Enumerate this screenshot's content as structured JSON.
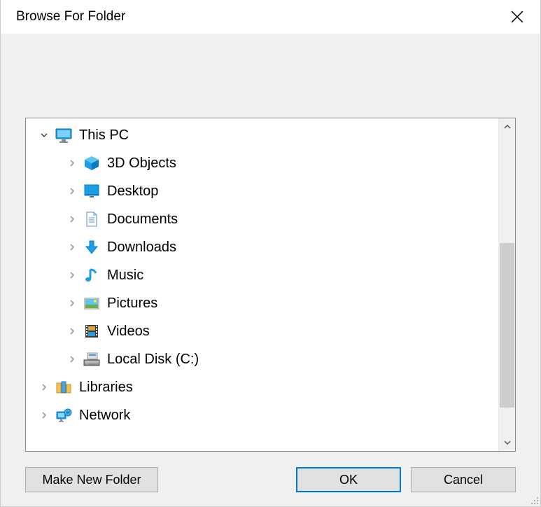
{
  "window": {
    "title": "Browse For Folder"
  },
  "tree": {
    "items": [
      {
        "label": "This PC",
        "icon": "monitor-icon",
        "depth": 0,
        "expanded": true
      },
      {
        "label": "3D Objects",
        "icon": "cube-icon",
        "depth": 1,
        "expanded": false
      },
      {
        "label": "Desktop",
        "icon": "desktop-icon",
        "depth": 1,
        "expanded": false
      },
      {
        "label": "Documents",
        "icon": "document-icon",
        "depth": 1,
        "expanded": false
      },
      {
        "label": "Downloads",
        "icon": "download-arrow-icon",
        "depth": 1,
        "expanded": false
      },
      {
        "label": "Music",
        "icon": "music-note-icon",
        "depth": 1,
        "expanded": false
      },
      {
        "label": "Pictures",
        "icon": "picture-icon",
        "depth": 1,
        "expanded": false
      },
      {
        "label": "Videos",
        "icon": "film-icon",
        "depth": 1,
        "expanded": false
      },
      {
        "label": "Local Disk (C:)",
        "icon": "drive-icon",
        "depth": 1,
        "expanded": false
      },
      {
        "label": "Libraries",
        "icon": "libraries-icon",
        "depth": 0,
        "expanded": false
      },
      {
        "label": "Network",
        "icon": "network-icon",
        "depth": 0,
        "expanded": false
      }
    ]
  },
  "buttons": {
    "make_new_folder": "Make New Folder",
    "ok": "OK",
    "cancel": "Cancel"
  }
}
